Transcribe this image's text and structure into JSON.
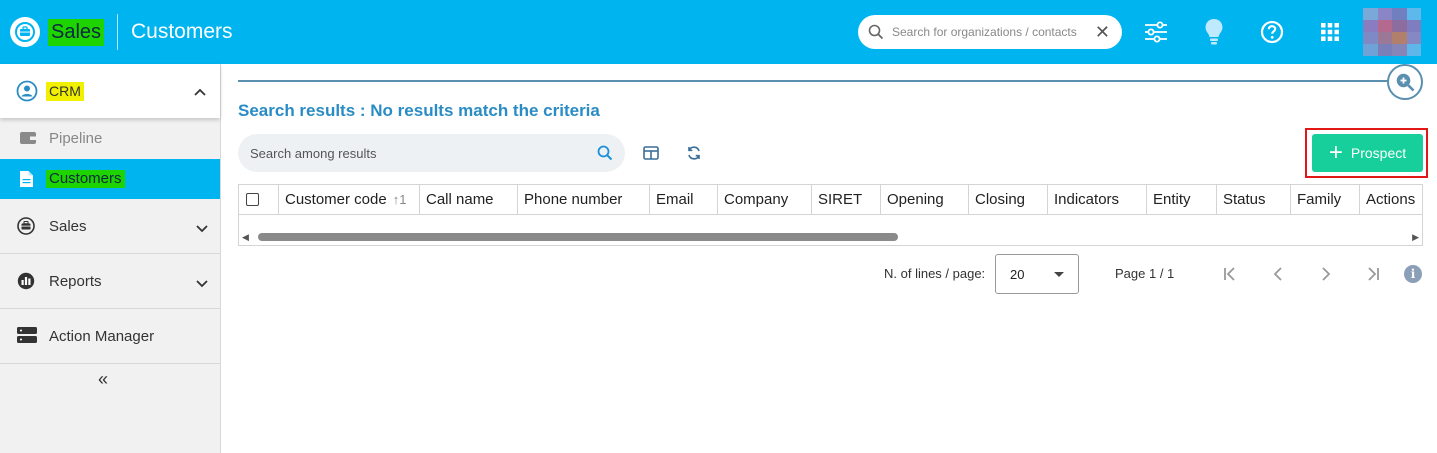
{
  "topbar": {
    "app_name": "Sales",
    "page_title": "Customers",
    "search": {
      "placeholder": "Search for organizations / contacts",
      "value": ""
    },
    "icons": [
      "filters-icon",
      "lightbulb-icon",
      "help-icon",
      "apps-grid-icon"
    ]
  },
  "sidebar": {
    "crm_label": "CRM",
    "sub_items": [
      {
        "label": "Pipeline",
        "active": false
      },
      {
        "label": "Customers",
        "active": true
      }
    ],
    "items": [
      {
        "label": "Sales"
      },
      {
        "label": "Reports"
      },
      {
        "label": "Action Manager"
      }
    ],
    "collapse_glyph": "«"
  },
  "main": {
    "results_title": "Search results : No results match the criteria",
    "result_search": {
      "placeholder": "Search among results",
      "value": ""
    },
    "prospect_button": {
      "icon": "+",
      "label": "Prospect"
    },
    "table": {
      "columns": [
        "Customer code",
        "Call name",
        "Phone number",
        "Email",
        "Company",
        "SIRET",
        "Opening",
        "Closing",
        "Indicators",
        "Entity",
        "Status",
        "Family",
        "Actions"
      ],
      "sort_indicator": "↑1",
      "rows": []
    },
    "pager": {
      "lines_label": "N. of lines / page:",
      "lines_value": "20",
      "page_info": "Page 1 / 1"
    }
  },
  "colors": {
    "topbar": "#00b4f0",
    "active_nav": "#00b4f0",
    "highlight_green": "#1ed400",
    "highlight_yellow": "#f0f000",
    "prospect_button": "#17cf9b",
    "results_title": "#2a8cc4"
  }
}
